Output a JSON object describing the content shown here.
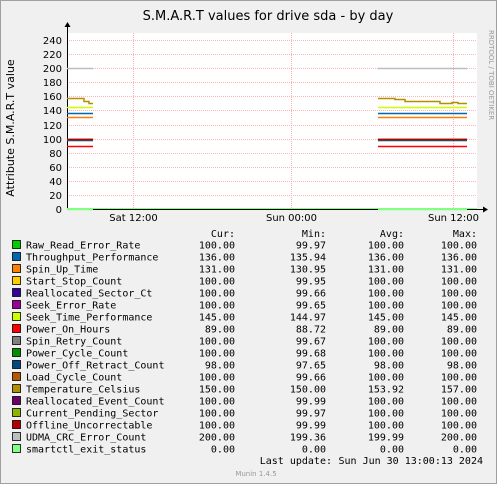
{
  "chart_data": {
    "type": "line",
    "title": "S.M.A.R.T values for drive sda - by day",
    "ylabel": "Attribute S.M.A.R.T value",
    "xlabel": "",
    "ylim": [
      0,
      250
    ],
    "yticks": [
      0,
      20,
      40,
      60,
      80,
      100,
      120,
      140,
      160,
      180,
      200,
      220,
      240
    ],
    "xticks": [
      "Sat 12:00",
      "Sun 00:00",
      "Sun 12:00"
    ],
    "grid": true,
    "legend_placement": "bottom",
    "column_headers": [
      "Cur:",
      "Min:",
      "Avg:",
      "Max:"
    ],
    "series": [
      {
        "name": "Raw_Read_Error_Rate",
        "color": "#00cc00",
        "cur": "100.00",
        "min": "99.97",
        "avg": "100.00",
        "max": "100.00",
        "value": 100
      },
      {
        "name": "Throughput_Performance",
        "color": "#0066b3",
        "cur": "136.00",
        "min": "135.94",
        "avg": "136.00",
        "max": "136.00",
        "value": 136
      },
      {
        "name": "Spin_Up_Time",
        "color": "#ff8000",
        "cur": "131.00",
        "min": "130.95",
        "avg": "131.00",
        "max": "131.00",
        "value": 131
      },
      {
        "name": "Start_Stop_Count",
        "color": "#ffcc00",
        "cur": "100.00",
        "min": "99.95",
        "avg": "100.00",
        "max": "100.00",
        "value": 100
      },
      {
        "name": "Reallocated_Sector_Ct",
        "color": "#330099",
        "cur": "100.00",
        "min": "99.66",
        "avg": "100.00",
        "max": "100.00",
        "value": 100
      },
      {
        "name": "Seek_Error_Rate",
        "color": "#990099",
        "cur": "100.00",
        "min": "99.65",
        "avg": "100.00",
        "max": "100.00",
        "value": 100
      },
      {
        "name": "Seek_Time_Performance",
        "color": "#ccff00",
        "cur": "145.00",
        "min": "144.97",
        "avg": "145.00",
        "max": "145.00",
        "value": 145
      },
      {
        "name": "Power_On_Hours",
        "color": "#ff0000",
        "cur": "89.00",
        "min": "88.72",
        "avg": "89.00",
        "max": "89.00",
        "value": 89
      },
      {
        "name": "Spin_Retry_Count",
        "color": "#808080",
        "cur": "100.00",
        "min": "99.67",
        "avg": "100.00",
        "max": "100.00",
        "value": 100
      },
      {
        "name": "Power_Cycle_Count",
        "color": "#008f00",
        "cur": "100.00",
        "min": "99.68",
        "avg": "100.00",
        "max": "100.00",
        "value": 100
      },
      {
        "name": "Power_Off_Retract_Count",
        "color": "#00487d",
        "cur": "98.00",
        "min": "97.65",
        "avg": "98.00",
        "max": "98.00",
        "value": 98
      },
      {
        "name": "Load_Cycle_Count",
        "color": "#b35a00",
        "cur": "100.00",
        "min": "99.66",
        "avg": "100.00",
        "max": "100.00",
        "value": 100
      },
      {
        "name": "Temperature_Celsius",
        "color": "#b38f00",
        "cur": "150.00",
        "min": "150.00",
        "avg": "153.92",
        "max": "157.00",
        "value": 150
      },
      {
        "name": "Reallocated_Event_Count",
        "color": "#6b006b",
        "cur": "100.00",
        "min": "99.99",
        "avg": "100.00",
        "max": "100.00",
        "value": 100
      },
      {
        "name": "Current_Pending_Sector",
        "color": "#8fb300",
        "cur": "100.00",
        "min": "99.97",
        "avg": "100.00",
        "max": "100.00",
        "value": 100
      },
      {
        "name": "Offline_Uncorrectable",
        "color": "#b30000",
        "cur": "100.00",
        "min": "99.99",
        "avg": "100.00",
        "max": "100.00",
        "value": 100
      },
      {
        "name": "UDMA_CRC_Error_Count",
        "color": "#bebebe",
        "cur": "200.00",
        "min": "199.36",
        "avg": "199.99",
        "max": "200.00",
        "value": 200
      },
      {
        "name": "smartctl_exit_status",
        "color": "#80ff80",
        "cur": "0.00",
        "min": "0.00",
        "avg": "0.00",
        "max": "0.00",
        "value": 0
      }
    ]
  },
  "side_label": "RRDTOOL / TOBI OETIKER",
  "footer": {
    "last_update_label": "Last update:",
    "last_update_value": "Sun Jun 30 13:00:13 2024",
    "version": "Munin 1.4.5"
  }
}
